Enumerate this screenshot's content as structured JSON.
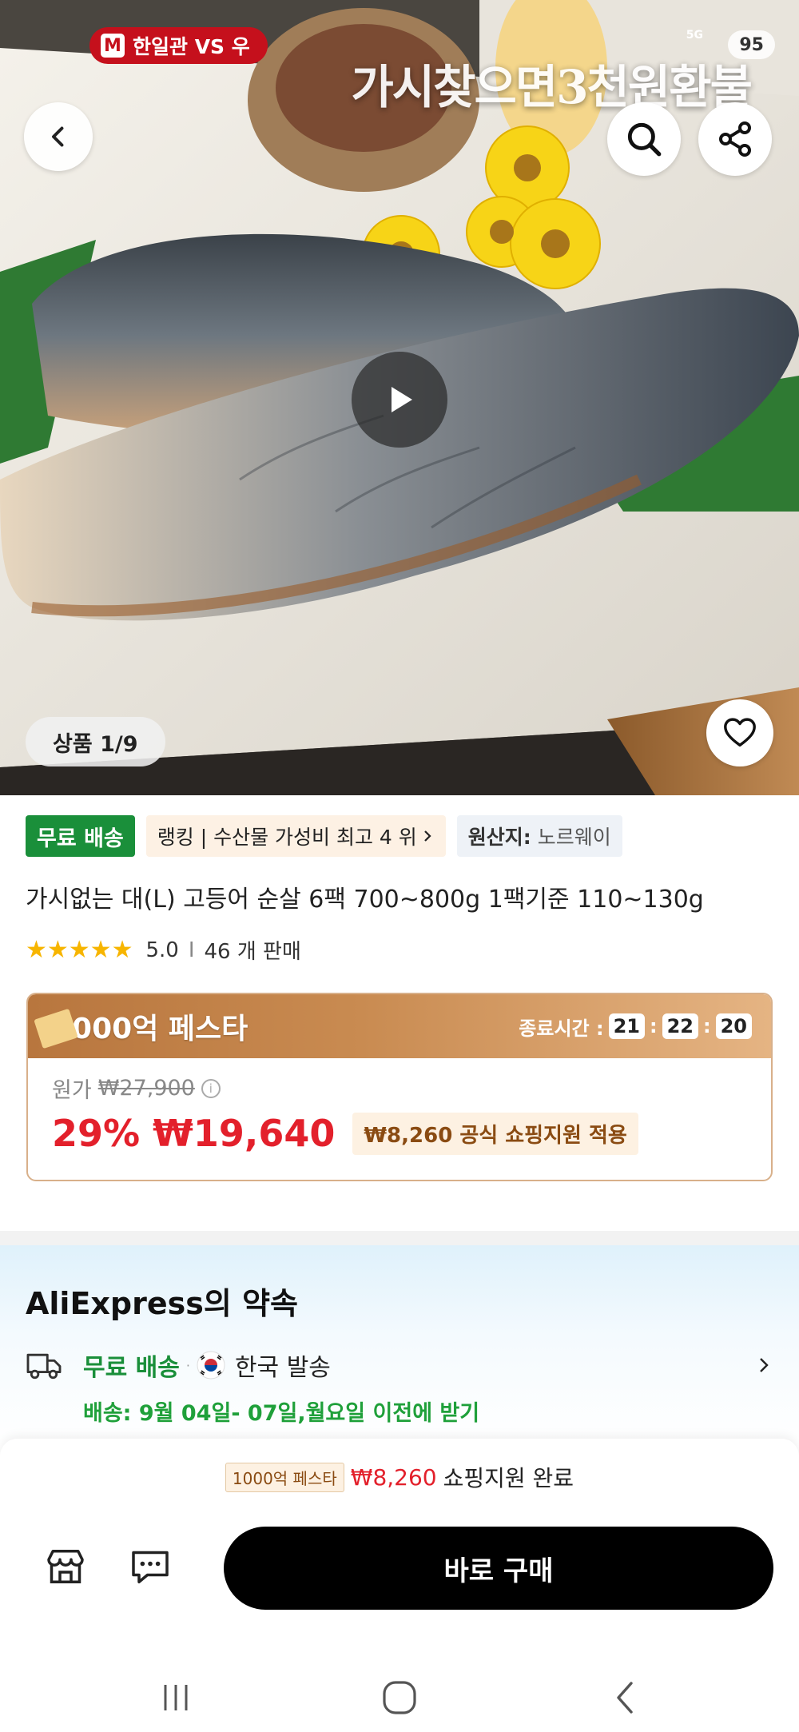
{
  "status_bar": {
    "app_badge": "한일관 VS 우",
    "network": "5G",
    "battery": "95"
  },
  "hero": {
    "caption": "가시찾으면3천원환불",
    "counter": "상품 1/9"
  },
  "tags": {
    "free_shipping": "무료 배송",
    "ranking": "랭킹 | 수산물 가성비 최고 4 위",
    "origin_label": "원산지:",
    "origin_value": "노르웨이"
  },
  "product": {
    "title": "가시없는 대(L) 고등어 순살 6팩 700~800g 1팩기준 110~130g",
    "rating": "5.0",
    "sold": "46 개 판매"
  },
  "promo": {
    "festival": "1000억 페스타",
    "ends_label": "종료시간 :",
    "hours": "21",
    "minutes": "22",
    "seconds": "20",
    "original_label": "원가",
    "original_price": "₩27,900",
    "discount": "29%",
    "price": "₩19,640",
    "coupon": "₩8,260 공식 쇼핑지원 적용"
  },
  "promise": {
    "title": "AliExpress의 약속",
    "free_shipping": "무료 배송",
    "dot": "·",
    "ships_from": "한국 발송",
    "delivery": "배송: 9월 04일- 07일,월요일 이전에 받기"
  },
  "bottom": {
    "fest_chip": "1000억 페스타",
    "support_amount": "₩8,260",
    "support_text": "쇼핑지원 완료",
    "buy_now": "바로 구매"
  },
  "colors": {
    "accent_red": "#e3202b",
    "green": "#1a8f3a",
    "promo_brown": "#b8763e",
    "buy_button": "#000000",
    "star": "#f7b500"
  },
  "icons": [
    "back-icon",
    "search-icon",
    "share-icon",
    "play-icon",
    "heart-icon",
    "star-icon",
    "info-icon",
    "truck-icon",
    "korea-flag-icon",
    "chevron-right-icon",
    "store-icon",
    "chat-icon",
    "recent-apps-icon",
    "home-icon",
    "nav-back-icon"
  ]
}
